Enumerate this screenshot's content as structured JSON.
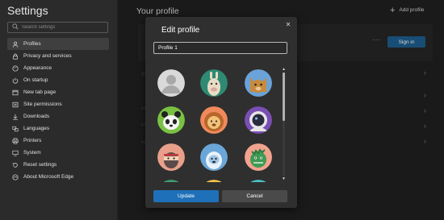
{
  "sidebar": {
    "title": "Settings",
    "search_placeholder": "Search settings",
    "items": [
      {
        "label": "Profiles",
        "icon": "person-icon",
        "active": true
      },
      {
        "label": "Privacy and services",
        "icon": "lock-icon"
      },
      {
        "label": "Appearance",
        "icon": "paint-icon"
      },
      {
        "label": "On startup",
        "icon": "power-icon"
      },
      {
        "label": "New tab page",
        "icon": "new-tab-icon"
      },
      {
        "label": "Site permissions",
        "icon": "site-permissions-icon"
      },
      {
        "label": "Downloads",
        "icon": "download-icon"
      },
      {
        "label": "Languages",
        "icon": "languages-icon"
      },
      {
        "label": "Printers",
        "icon": "printer-icon"
      },
      {
        "label": "System",
        "icon": "system-icon"
      },
      {
        "label": "Reset settings",
        "icon": "reset-icon"
      },
      {
        "label": "About Microsoft Edge",
        "icon": "edge-icon"
      }
    ]
  },
  "main": {
    "title": "Your profile",
    "add_profile_label": "Add profile",
    "more_label": "···",
    "sign_in_label": "Sign in"
  },
  "dialog": {
    "title": "Edit profile",
    "close_label": "✕",
    "profile_name_value": "Profile 1",
    "update_label": "Update",
    "cancel_label": "Cancel",
    "avatars": [
      "default-person",
      "llama",
      "cat",
      "panda",
      "lion",
      "astronaut",
      "ninja",
      "yeti",
      "dinosaur"
    ]
  },
  "colors": {
    "accent": "#1e70b8",
    "sidebar_bg": "#2b2b2b",
    "dialog_bg": "#2f2f2f"
  }
}
